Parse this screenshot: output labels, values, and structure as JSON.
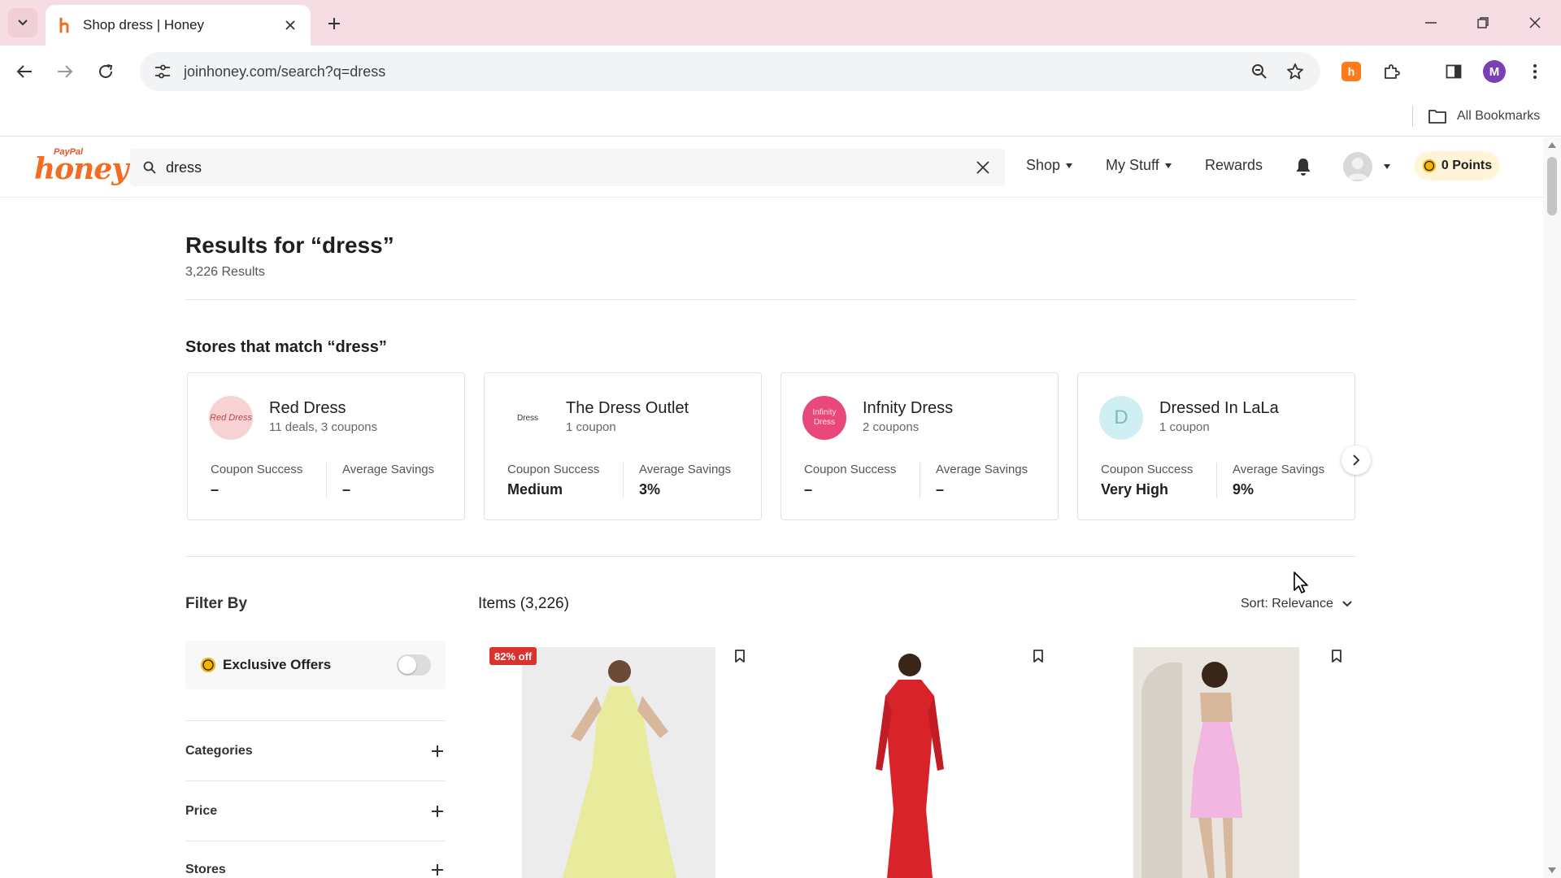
{
  "browser": {
    "tab_title": "Shop dress | Honey",
    "url": "joinhoney.com/search?q=dress",
    "bookmarks_label": "All Bookmarks",
    "profile_initial": "M",
    "extension_letter": "h"
  },
  "header": {
    "logo_top": "PayPal",
    "logo_main": "honey",
    "search_value": "dress",
    "nav": {
      "shop": "Shop",
      "my_stuff": "My Stuff",
      "rewards": "Rewards"
    },
    "points": "0 Points"
  },
  "results": {
    "title": "Results for “dress”",
    "count": "3,226 Results"
  },
  "stores": {
    "title": "Stores that match “dress”",
    "items": [
      {
        "name": "Red Dress",
        "deals": "11 deals, 3 coupons",
        "logo_text": "Red Dress",
        "coupon_label": "Coupon Success",
        "coupon_value": "–",
        "savings_label": "Average Savings",
        "savings_value": "–"
      },
      {
        "name": "The Dress Outlet",
        "deals": "1 coupon",
        "logo_text": "Dress",
        "coupon_label": "Coupon Success",
        "coupon_value": "Medium",
        "savings_label": "Average Savings",
        "savings_value": "3%"
      },
      {
        "name": "Infnity Dress",
        "deals": "2 coupons",
        "logo_text": "Infinity Dress",
        "coupon_label": "Coupon Success",
        "coupon_value": "–",
        "savings_label": "Average Savings",
        "savings_value": "–"
      },
      {
        "name": "Dressed In LaLa",
        "deals": "1 coupon",
        "logo_text": "D",
        "coupon_label": "Coupon Success",
        "coupon_value": "Very High",
        "savings_label": "Average Savings",
        "savings_value": "9%"
      }
    ]
  },
  "filters": {
    "title": "Filter By",
    "exclusive_label": "Exclusive Offers",
    "exclusive_on": false,
    "facets": [
      "Categories",
      "Price",
      "Stores"
    ]
  },
  "items": {
    "title": "Items (3,226)",
    "sort_label": "Sort: Relevance",
    "products": [
      {
        "badge": "82% off",
        "color": "#e8ea9c"
      },
      {
        "badge": "",
        "color": "#d9232b"
      },
      {
        "badge": "",
        "color": "#f2b6e2"
      }
    ]
  },
  "colors": {
    "accent": "#f26c25",
    "tabstrip": "#f6dde3",
    "discount_badge": "#d9332f"
  }
}
